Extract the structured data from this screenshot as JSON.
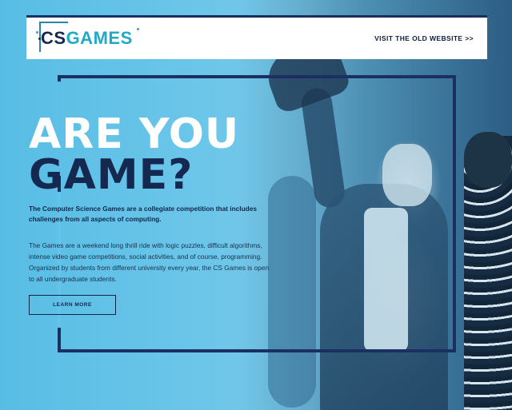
{
  "header": {
    "logo_cs": "CS",
    "logo_games": "GAMES",
    "old_site_link": "VISIT THE OLD WEBSITE >>"
  },
  "hero": {
    "headline_line1": "ARE YOU",
    "headline_line2": "GAME?",
    "intro": "The Computer Science Games are a collegiate competition that includes challenges from all aspects of computing.",
    "description": "The Games are a weekend long thrill ride with logic puzzles, difficult algorithms, intense video game competitions, social activities, and of course, programming. Organized by students from different university every year, the CS Games is open to all undergraduate students.",
    "cta_label": "LEARN MORE"
  },
  "colors": {
    "navy": "#15284f",
    "frame": "#1b2f63",
    "sky": "#6cc6ea",
    "teal": "#22a9c6"
  }
}
